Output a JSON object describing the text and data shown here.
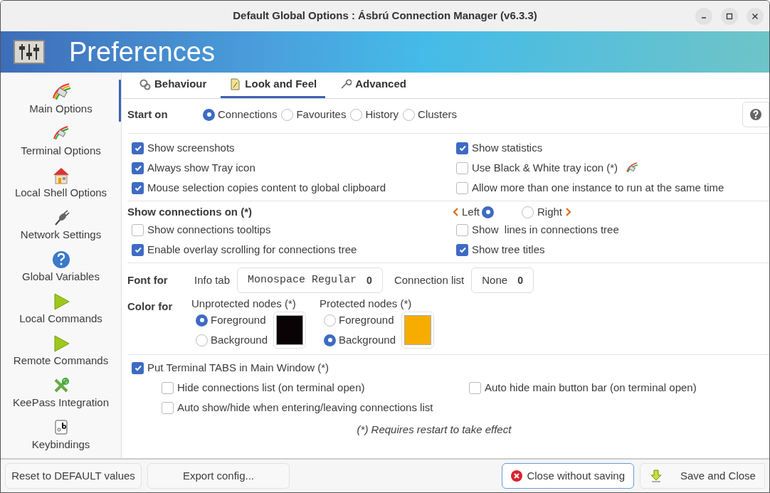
{
  "window": {
    "title": "Default Global Options : Ásbrú Connection Manager (v6.3.3)"
  },
  "header": {
    "title": "Preferences"
  },
  "sidebar": {
    "items": [
      {
        "label": "Main Options",
        "selected": true
      },
      {
        "label": "Terminal Options",
        "selected": false
      },
      {
        "label": "Local Shell Options",
        "selected": false
      },
      {
        "label": "Network Settings",
        "selected": false
      },
      {
        "label": "Global Variables",
        "selected": false
      },
      {
        "label": "Local Commands",
        "selected": false
      },
      {
        "label": "Remote Commands",
        "selected": false
      },
      {
        "label": "KeePass Integration",
        "selected": false
      },
      {
        "label": "Keybindings",
        "selected": false
      }
    ]
  },
  "tabs": [
    {
      "label": "Behaviour",
      "selected": false
    },
    {
      "label": "Look and Feel",
      "selected": true
    },
    {
      "label": "Advanced",
      "selected": false
    }
  ],
  "start_on": {
    "label": "Start on",
    "options": [
      {
        "label": "Connections",
        "selected": true
      },
      {
        "label": "Favourites",
        "selected": false
      },
      {
        "label": "History",
        "selected": false
      },
      {
        "label": "Clusters",
        "selected": false
      }
    ]
  },
  "general": {
    "left": [
      {
        "label": "Show screenshots",
        "checked": true
      },
      {
        "label": "Always show Tray icon",
        "checked": true
      },
      {
        "label": "Mouse selection copies content to global clipboard",
        "checked": true
      }
    ],
    "right": [
      {
        "label": "Show statistics",
        "checked": true
      },
      {
        "label": "Use Black & White tray icon (*)",
        "checked": false
      },
      {
        "label": "Allow more than one instance to run at the same time",
        "checked": false
      }
    ]
  },
  "show_connections": {
    "label": "Show connections on (*)",
    "sides": [
      {
        "label": "Left",
        "selected": true
      },
      {
        "label": "Right",
        "selected": false
      }
    ],
    "left": [
      {
        "label": "Show connections tooltips",
        "checked": false
      },
      {
        "label": "Enable overlay scrolling for connections tree",
        "checked": true
      }
    ],
    "right": [
      {
        "label": "Show  lines in connections tree",
        "checked": false
      },
      {
        "label": "Show tree titles",
        "checked": true
      }
    ]
  },
  "font_for": {
    "label": "Font for",
    "fields": [
      {
        "label": "Info tab",
        "font": "Monospace Regular",
        "size": "0"
      },
      {
        "label": "Connection list",
        "font": "None",
        "size": "0"
      }
    ]
  },
  "color_for": {
    "label": "Color for",
    "groups": [
      {
        "label": "Unprotected nodes (*)",
        "color": "#0a0305",
        "options": [
          {
            "label": "Foreground",
            "selected": true
          },
          {
            "label": "Background",
            "selected": false
          }
        ]
      },
      {
        "label": "Protected nodes (*)",
        "color": "#f6ad00",
        "options": [
          {
            "label": "Foreground",
            "selected": false
          },
          {
            "label": "Background",
            "selected": true
          }
        ]
      }
    ]
  },
  "terminal_tabs": {
    "label": "Put Terminal TABS in Main Window (*)",
    "checked": true,
    "options": [
      {
        "label": "Hide connections list (on terminal open)",
        "checked": false
      },
      {
        "label": "Auto hide main button bar (on terminal open)",
        "checked": false
      },
      {
        "label": "Auto show/hide when entering/leaving connections list",
        "checked": false
      }
    ]
  },
  "note": "(*) Requires restart to take effect",
  "buttons": [
    {
      "label": "Reset to DEFAULT values",
      "kind": "plain"
    },
    {
      "label": "Export config...",
      "kind": "plain"
    },
    {
      "label": "Close without saving",
      "kind": "cancel"
    },
    {
      "label": "Save and Close",
      "kind": "save"
    }
  ]
}
